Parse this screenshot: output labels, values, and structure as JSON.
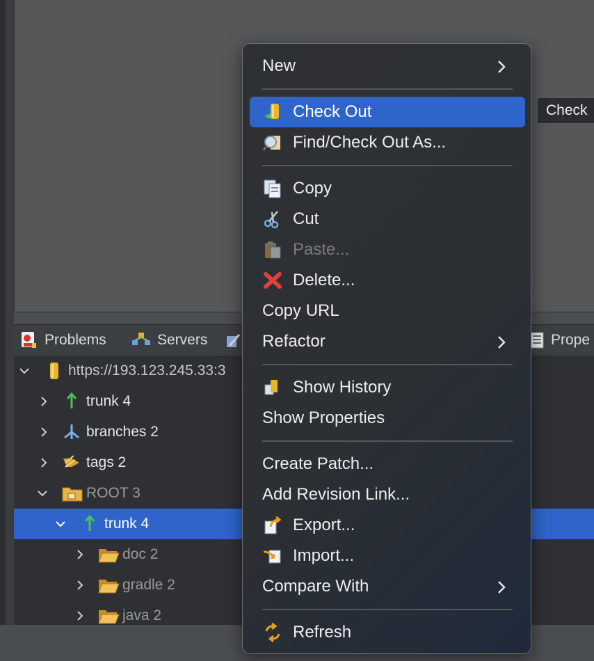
{
  "context_menu": {
    "items": [
      {
        "label": "New"
      },
      {
        "label": "Check Out"
      },
      {
        "label": "Find/Check Out As..."
      },
      {
        "label": "Copy"
      },
      {
        "label": "Cut"
      },
      {
        "label": "Paste..."
      },
      {
        "label": "Delete..."
      },
      {
        "label": "Copy URL"
      },
      {
        "label": "Refactor"
      },
      {
        "label": "Show History"
      },
      {
        "label": "Show Properties"
      },
      {
        "label": "Create Patch..."
      },
      {
        "label": "Add Revision Link..."
      },
      {
        "label": "Export..."
      },
      {
        "label": "Import..."
      },
      {
        "label": "Compare With"
      },
      {
        "label": "Refresh"
      }
    ]
  },
  "tooltip": {
    "text": "Check"
  },
  "tabs": [
    {
      "label": "Problems"
    },
    {
      "label": "Servers"
    },
    {
      "label": "Prope"
    }
  ],
  "tree": {
    "rows": [
      {
        "label": "https://193.123.245.33:3"
      },
      {
        "label": "trunk 4"
      },
      {
        "label": "branches 2"
      },
      {
        "label": "tags 2"
      },
      {
        "label": "ROOT 3"
      },
      {
        "label": "trunk 4"
      },
      {
        "label": "doc 2"
      },
      {
        "label": "gradle 2"
      },
      {
        "label": "java 2"
      }
    ]
  },
  "colors": {
    "selection": "#2f65ca",
    "menu_bg": "#2e3134",
    "panel_bg": "#2e3033"
  }
}
